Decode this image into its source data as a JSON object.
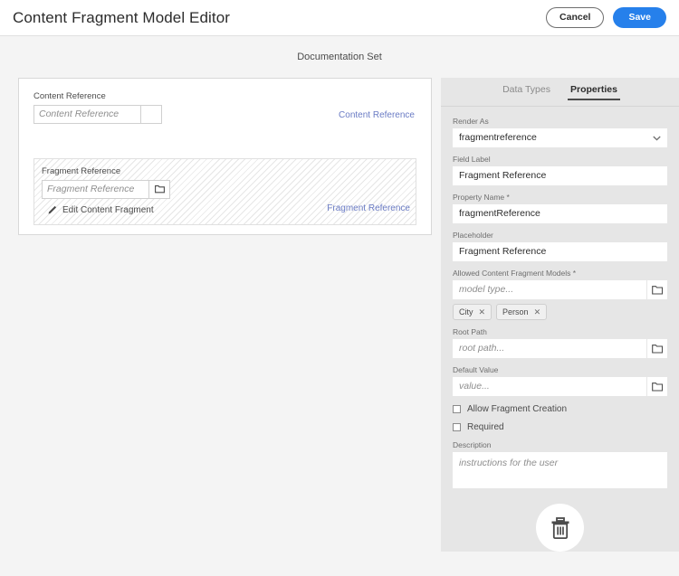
{
  "header": {
    "title": "Content Fragment Model Editor",
    "cancel_label": "Cancel",
    "save_label": "Save",
    "save_color": "#2680eb"
  },
  "subtitle": {
    "text": "Documentation Set"
  },
  "editor": {
    "fields": [
      {
        "label": "Content Reference",
        "placeholder": "Content Reference",
        "type_link": "Content Reference",
        "has_folder_icon": false,
        "dragging": false,
        "edit_link": null
      },
      {
        "label": "Fragment Reference",
        "placeholder": "Fragment Reference",
        "type_link": "Fragment Reference",
        "has_folder_icon": true,
        "dragging": true,
        "edit_link": "Edit Content Fragment"
      }
    ],
    "link_color": "#6a7bc4"
  },
  "properties_panel": {
    "tabs": [
      {
        "label": "Data Types",
        "active": false
      },
      {
        "label": "Properties",
        "active": true
      }
    ],
    "render_as": {
      "label": "Render As",
      "value": "fragmentreference"
    },
    "field_label": {
      "label": "Field Label",
      "value": "Fragment Reference"
    },
    "property_name": {
      "label": "Property Name *",
      "value": "fragmentReference"
    },
    "placeholder_field": {
      "label": "Placeholder",
      "value": "Fragment Reference"
    },
    "allowed_models": {
      "label": "Allowed Content Fragment Models *",
      "placeholder": "model type...",
      "tags": [
        "City",
        "Person"
      ]
    },
    "root_path": {
      "label": "Root Path",
      "placeholder": "root path..."
    },
    "default_value": {
      "label": "Default Value",
      "placeholder": "value..."
    },
    "checkboxes": [
      {
        "label": "Allow Fragment Creation",
        "checked": false
      },
      {
        "label": "Required",
        "checked": false
      }
    ],
    "description": {
      "label": "Description",
      "placeholder": "instructions for the user"
    },
    "delete_button": "delete"
  }
}
